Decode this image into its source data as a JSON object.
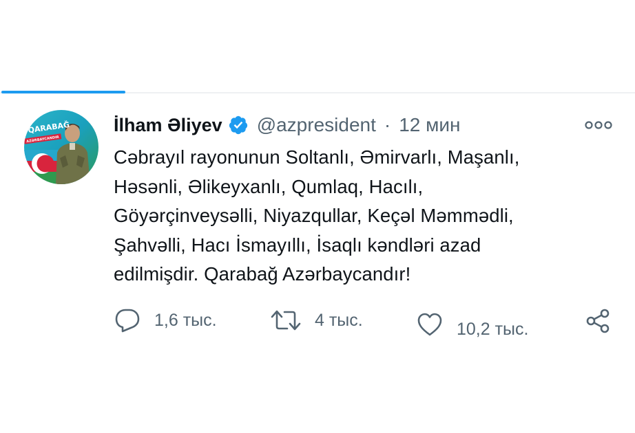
{
  "tweet": {
    "display_name": "İlham Əliyev",
    "handle": "@azpresident",
    "separator": "·",
    "time": "12 мин",
    "text_lines": [
      "Cəbrayıl rayonunun Soltanlı, Əmirvarlı, Maşanlı,",
      "Həsənli, Əlikeyxanlı, Qumlaq, Hacılı,",
      "Göyərçinveysəlli, Niyazqullar, Keçəl Məmmədli,",
      "Şahvəlli, Hacı İsmayıllı, İsaqlı kəndləri azad",
      "edilmişdir. Qarabağ Azərbaycandır!"
    ],
    "avatar": {
      "banner_text": "QARABAĞ",
      "sub_text": "AZƏRBAYCANDIR"
    }
  },
  "actions": {
    "reply_count": "1,6 тыс.",
    "retweet_count": "4 тыс.",
    "like_count": "10,2 тыс."
  },
  "icons": {
    "verified": "verified-badge-icon",
    "more": "more-icon",
    "reply": "reply-icon",
    "retweet": "retweet-icon",
    "like": "heart-icon",
    "share": "share-icon"
  },
  "colors": {
    "accent": "#1d9bf0",
    "text": "#0f1419",
    "secondary": "#536471"
  }
}
